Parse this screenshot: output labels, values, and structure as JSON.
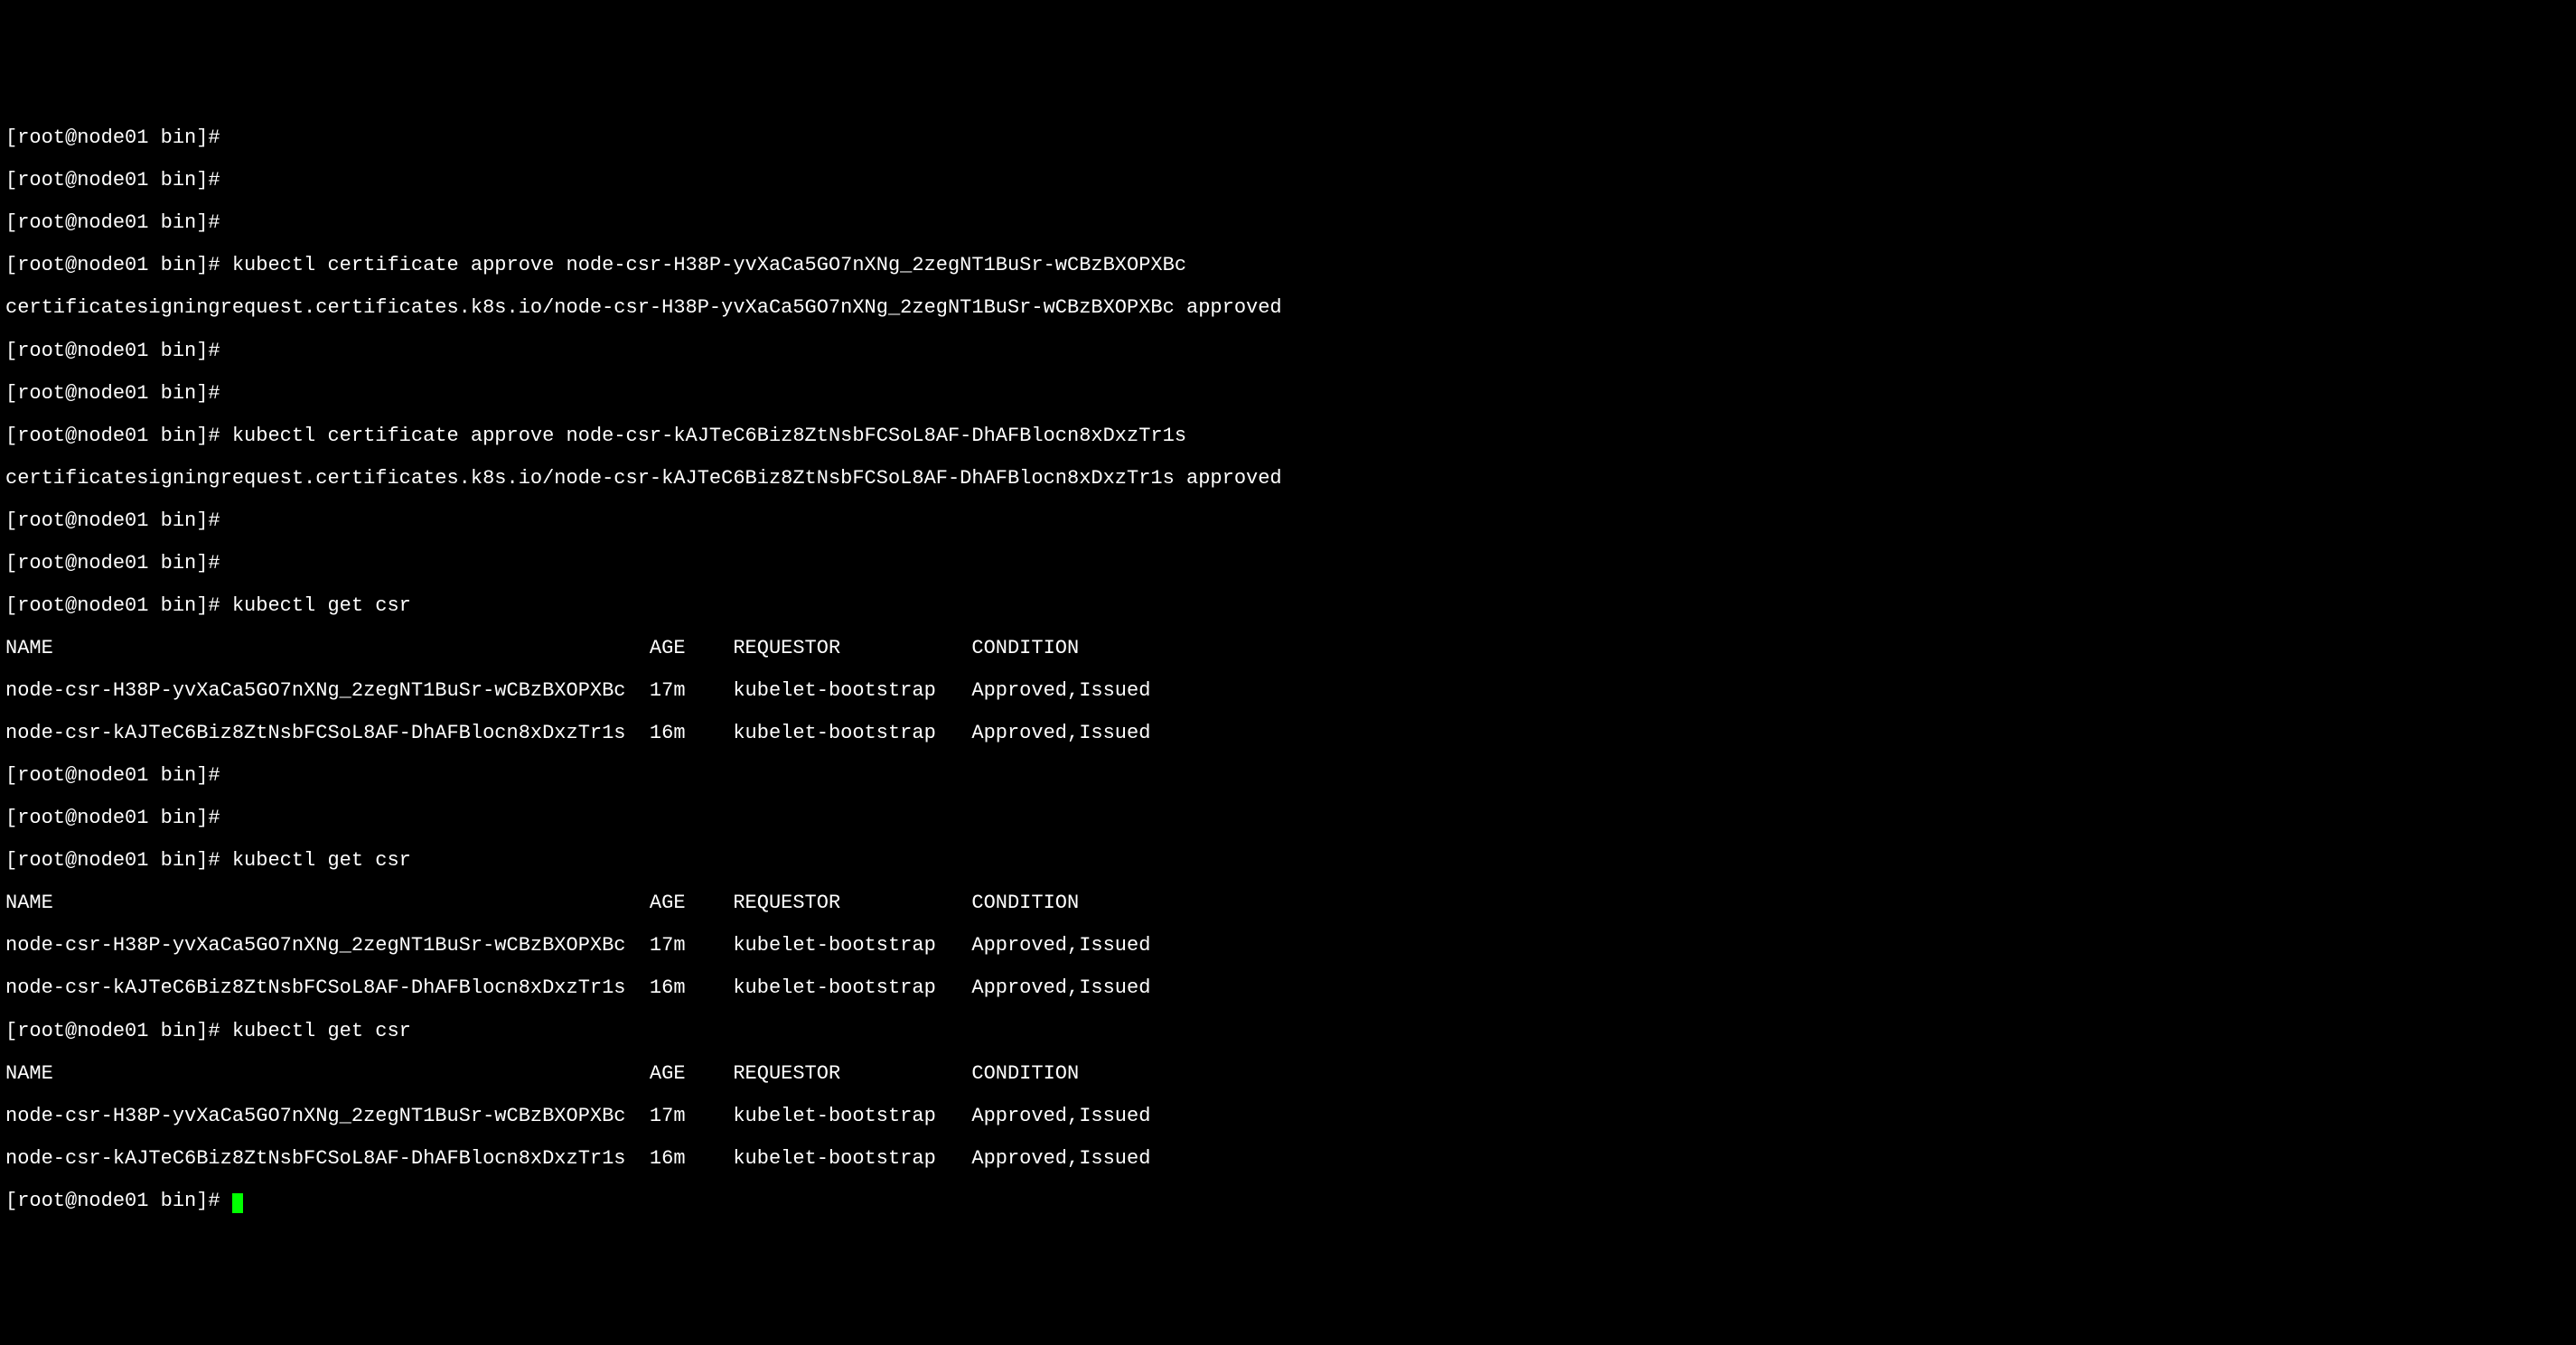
{
  "prompt": "[root@node01 bin]# ",
  "cmds": {
    "approve1": "kubectl certificate approve node-csr-H38P-yvXaCa5GO7nXNg_2zegNT1BuSr-wCBzBXOPXBc",
    "approve1_resp": "certificatesigningrequest.certificates.k8s.io/node-csr-H38P-yvXaCa5GO7nXNg_2zegNT1BuSr-wCBzBXOPXBc approved",
    "approve2": "kubectl certificate approve node-csr-kAJTeC6Biz8ZtNsbFCSoL8AF-DhAFBlocn8xDxzTr1s",
    "approve2_resp": "certificatesigningrequest.certificates.k8s.io/node-csr-kAJTeC6Biz8ZtNsbFCSoL8AF-DhAFBlocn8xDxzTr1s approved",
    "getcsr": "kubectl get csr"
  },
  "table": {
    "header": {
      "name": "NAME",
      "age": "AGE",
      "requestor": "REQUESTOR",
      "condition": "CONDITION"
    },
    "rows": [
      {
        "name": "node-csr-H38P-yvXaCa5GO7nXNg_2zegNT1BuSr-wCBzBXOPXBc",
        "age": "17m",
        "requestor": "kubelet-bootstrap",
        "condition": "Approved,Issued"
      },
      {
        "name": "node-csr-kAJTeC6Biz8ZtNsbFCSoL8AF-DhAFBlocn8xDxzTr1s",
        "age": "16m",
        "requestor": "kubelet-bootstrap",
        "condition": "Approved,Issued"
      }
    ]
  },
  "cols": {
    "name": 54,
    "age": 7,
    "requestor": 20
  }
}
